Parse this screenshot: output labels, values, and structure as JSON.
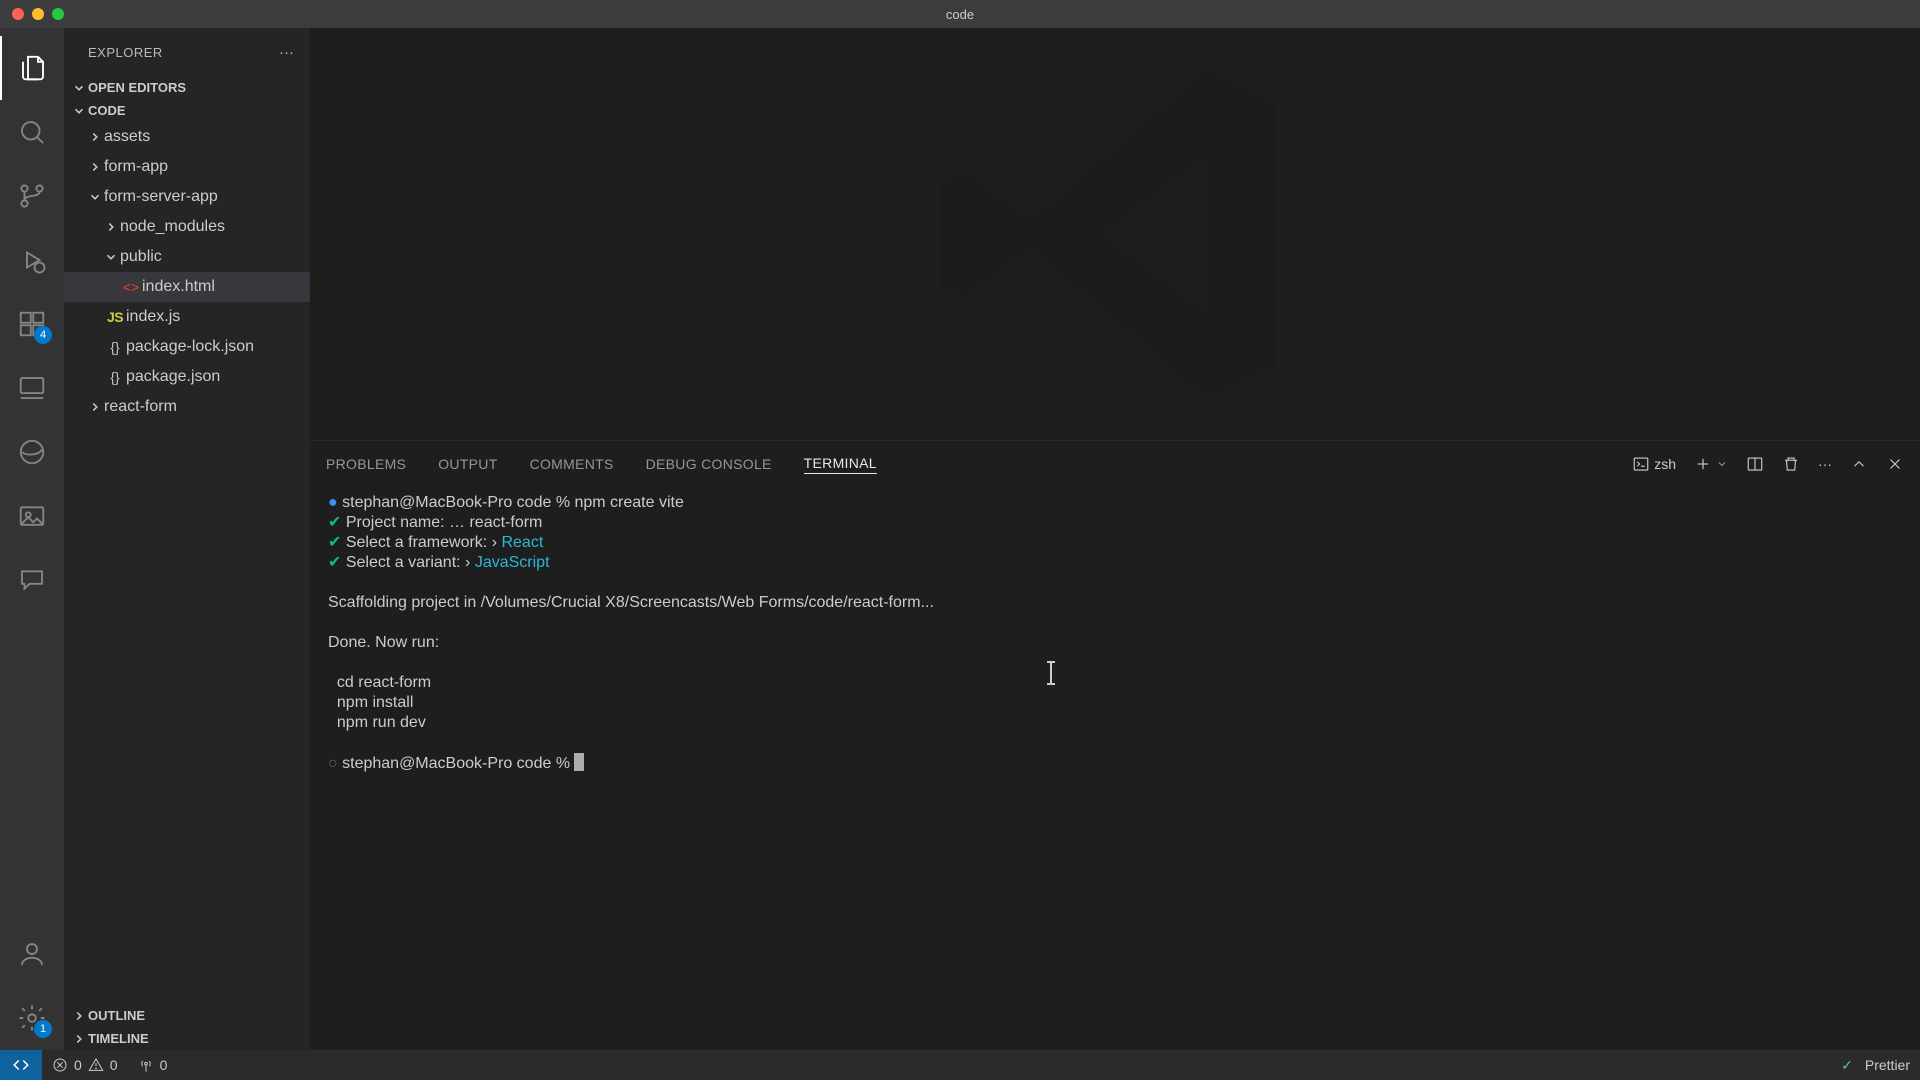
{
  "window": {
    "title": "code"
  },
  "explorer": {
    "title": "EXPLORER",
    "open_editors_label": "OPEN EDITORS",
    "workspace_label": "CODE",
    "outline_label": "OUTLINE",
    "timeline_label": "TIMELINE",
    "tree": {
      "assets": "assets",
      "form_app": "form-app",
      "form_server_app": "form-server-app",
      "node_modules": "node_modules",
      "public": "public",
      "index_html": "index.html",
      "index_js": "index.js",
      "package_lock": "package-lock.json",
      "package_json": "package.json",
      "react_form": "react-form"
    }
  },
  "activity": {
    "extensions_badge": "4",
    "settings_badge": "1"
  },
  "panel": {
    "tabs": {
      "problems": "PROBLEMS",
      "output": "OUTPUT",
      "comments": "COMMENTS",
      "debug_console": "DEBUG CONSOLE",
      "terminal": "TERMINAL"
    },
    "shell": "zsh"
  },
  "terminal": {
    "line1_prompt": "stephan@MacBook-Pro code % ",
    "line1_cmd": "npm create vite",
    "line2_label": "Project name: ",
    "line2_sep": "… ",
    "line2_val": "react-form",
    "line3_label": "Select a framework: ",
    "line3_sep": "› ",
    "line3_val": "React",
    "line4_label": "Select a variant: ",
    "line4_sep": "› ",
    "line4_val": "JavaScript",
    "line5": "Scaffolding project in /Volumes/Crucial X8/Screencasts/Web Forms/code/react-form...",
    "line6": "Done. Now run:",
    "line7": "  cd react-form",
    "line8": "  npm install",
    "line9": "  npm run dev",
    "line10_prompt": "stephan@MacBook-Pro code % "
  },
  "statusbar": {
    "errors": "0",
    "warnings": "0",
    "ports": "0",
    "prettier": "Prettier"
  }
}
